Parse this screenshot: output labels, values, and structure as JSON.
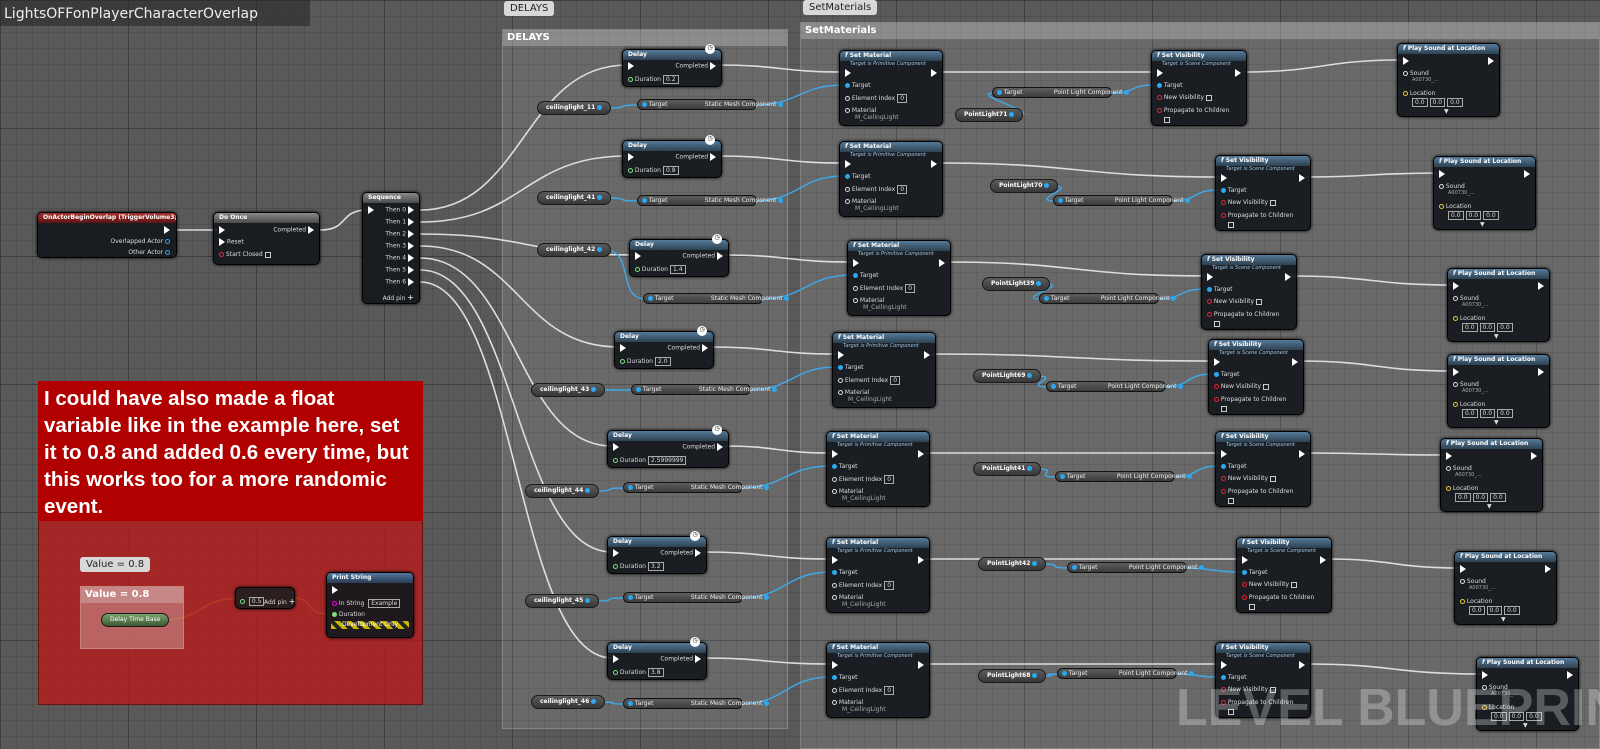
{
  "title": "LightsOFFonPlayerCharacterOverlap",
  "comments": {
    "delays": "DELAYS",
    "setmaterials": "SetMaterials"
  },
  "bubbles": {
    "delays": "DELAYS",
    "setmaterials": "SetMaterials",
    "value": "Value = 0.8"
  },
  "event": {
    "title": "OnActorBeginOverlap (TriggerVolume3)",
    "overlapped": "Overlapped Actor",
    "other": "Other Actor"
  },
  "doonce": {
    "title": "Do Once",
    "completed": "Completed",
    "reset": "Reset",
    "start_closed": "Start Closed"
  },
  "sequence": {
    "title": "Sequence",
    "thens": [
      "Then 0",
      "Then 1",
      "Then 2",
      "Then 3",
      "Then 4",
      "Then 5",
      "Then 6"
    ],
    "add_pin": "Add pin"
  },
  "delay": {
    "title": "Delay",
    "completed": "Completed",
    "duration": "Duration"
  },
  "delays": [
    "0.2",
    "0.8",
    "1.4",
    "2.0",
    "2.5999999",
    "3.2",
    "3.8"
  ],
  "ceiling": [
    "ceilinglight_11",
    "ceilinglight_41",
    "ceilinglight_42",
    "ceilinglight_43",
    "ceilinglight_44",
    "ceilinglight_45",
    "ceilinglight_46"
  ],
  "target_label": "Target",
  "static_mesh": "Static Mesh Component",
  "point_comp": "Point Light Component",
  "setmat": {
    "title": "Set Material",
    "subtitle": "Target is Primitive Component",
    "target": "Target",
    "element": "Element Index",
    "element_val": "0",
    "material": "Material",
    "material_val": "M_CeilingLight"
  },
  "setvis": {
    "title": "Set Visibility",
    "subtitle": "Target is Scene Component",
    "target": "Target",
    "new_vis": "New Visibility",
    "propagate": "Propagate to Children"
  },
  "points": [
    "PointLight71",
    "PointLight70",
    "PointLight39",
    "PointLight69",
    "PointLight41",
    "PointLight42",
    "PointLight68"
  ],
  "sound": {
    "title": "Play Sound at Location",
    "sound": "Sound",
    "sound_val": "A00730_...",
    "location": "Location",
    "loc_val": "0.0"
  },
  "note": "I could have also made a float variable like in the example here, set it to 0.8 and added 0.6 every time, but this works too for a more randomic event.",
  "example": {
    "var": "Delay Time Base",
    "add_val": "0.5",
    "add_pin": "Add pin",
    "print": "Print String",
    "in_string": "In String",
    "in_val": "Example",
    "duration": "Duration",
    "dev": "Development Only"
  },
  "watermark": "LEVEL BLUEPRINT"
}
